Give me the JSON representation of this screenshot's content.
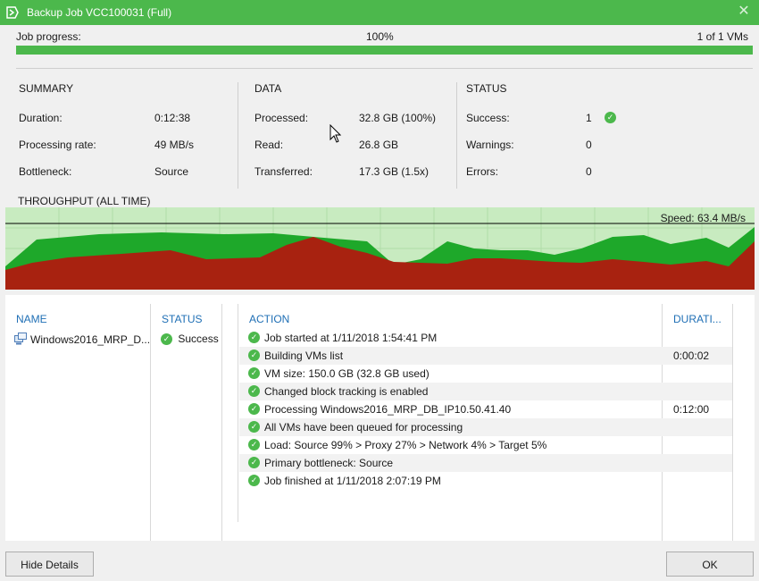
{
  "window": {
    "title": "Backup Job VCC100031 (Full)",
    "accent": "#4cb84c"
  },
  "progress": {
    "label": "Job progress:",
    "percent_text": "100%",
    "count_text": "1 of 1 VMs",
    "fraction": 1.0
  },
  "summary": {
    "heading": "SUMMARY",
    "rows": [
      {
        "label": "Duration:",
        "value": "0:12:38"
      },
      {
        "label": "Processing rate:",
        "value": "49 MB/s"
      },
      {
        "label": "Bottleneck:",
        "value": "Source"
      }
    ]
  },
  "data_section": {
    "heading": "DATA",
    "rows": [
      {
        "label": "Processed:",
        "value": "32.8 GB (100%)"
      },
      {
        "label": "Read:",
        "value": "26.8 GB"
      },
      {
        "label": "Transferred:",
        "value": "17.3 GB (1.5x)"
      }
    ]
  },
  "status_section": {
    "heading": "STATUS",
    "rows": [
      {
        "label": "Success:",
        "value": "1"
      },
      {
        "label": "Warnings:",
        "value": "0"
      },
      {
        "label": "Errors:",
        "value": "0"
      }
    ]
  },
  "throughput": {
    "title": "THROUGHPUT (ALL TIME)",
    "speed_label": "Speed: 63.4 MB/s",
    "colors": {
      "background": "#c8ebc0",
      "processing": "#1ea82a",
      "transfer": "#a82210"
    }
  },
  "details": {
    "columns": {
      "name": "NAME",
      "status": "STATUS",
      "action": "ACTION",
      "duration": "DURATI..."
    },
    "vm": {
      "name": "Windows2016_MRP_D...",
      "status": "Success"
    },
    "log": [
      {
        "message": "Job started at 1/11/2018 1:54:41 PM",
        "duration": ""
      },
      {
        "message": "Building VMs list",
        "duration": "0:00:02"
      },
      {
        "message": "VM size: 150.0 GB (32.8 GB used)",
        "duration": ""
      },
      {
        "message": "Changed block tracking is enabled",
        "duration": ""
      },
      {
        "message": "Processing Windows2016_MRP_DB_IP10.50.41.40",
        "duration": "0:12:00"
      },
      {
        "message": "All VMs have been queued for processing",
        "duration": ""
      },
      {
        "message": "Load: Source 99% > Proxy 27% > Network 4% > Target 5%",
        "duration": ""
      },
      {
        "message": "Primary bottleneck: Source",
        "duration": ""
      },
      {
        "message": "Job finished at 1/11/2018 2:07:19 PM",
        "duration": ""
      }
    ]
  },
  "buttons": {
    "hide_details": "Hide Details",
    "ok": "OK"
  }
}
